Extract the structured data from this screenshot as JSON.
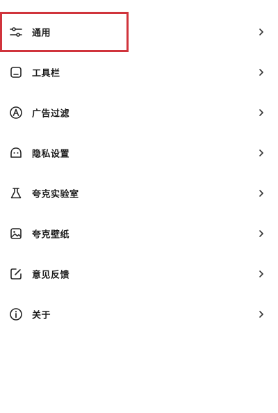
{
  "menu": {
    "items": [
      {
        "label": "通用",
        "icon": "sliders-icon"
      },
      {
        "label": "工具栏",
        "icon": "toolbar-icon"
      },
      {
        "label": "广告过滤",
        "icon": "ad-filter-icon"
      },
      {
        "label": "隐私设置",
        "icon": "privacy-icon"
      },
      {
        "label": "夸克实验室",
        "icon": "flask-icon"
      },
      {
        "label": "夸克壁纸",
        "icon": "wallpaper-icon"
      },
      {
        "label": "意见反馈",
        "icon": "feedback-edit-icon"
      },
      {
        "label": "关于",
        "icon": "info-icon"
      }
    ],
    "highlighted_item": "通用"
  },
  "colors": {
    "highlight_border": "#d0343c",
    "text": "#1c1c1c",
    "background": "#ffffff"
  }
}
